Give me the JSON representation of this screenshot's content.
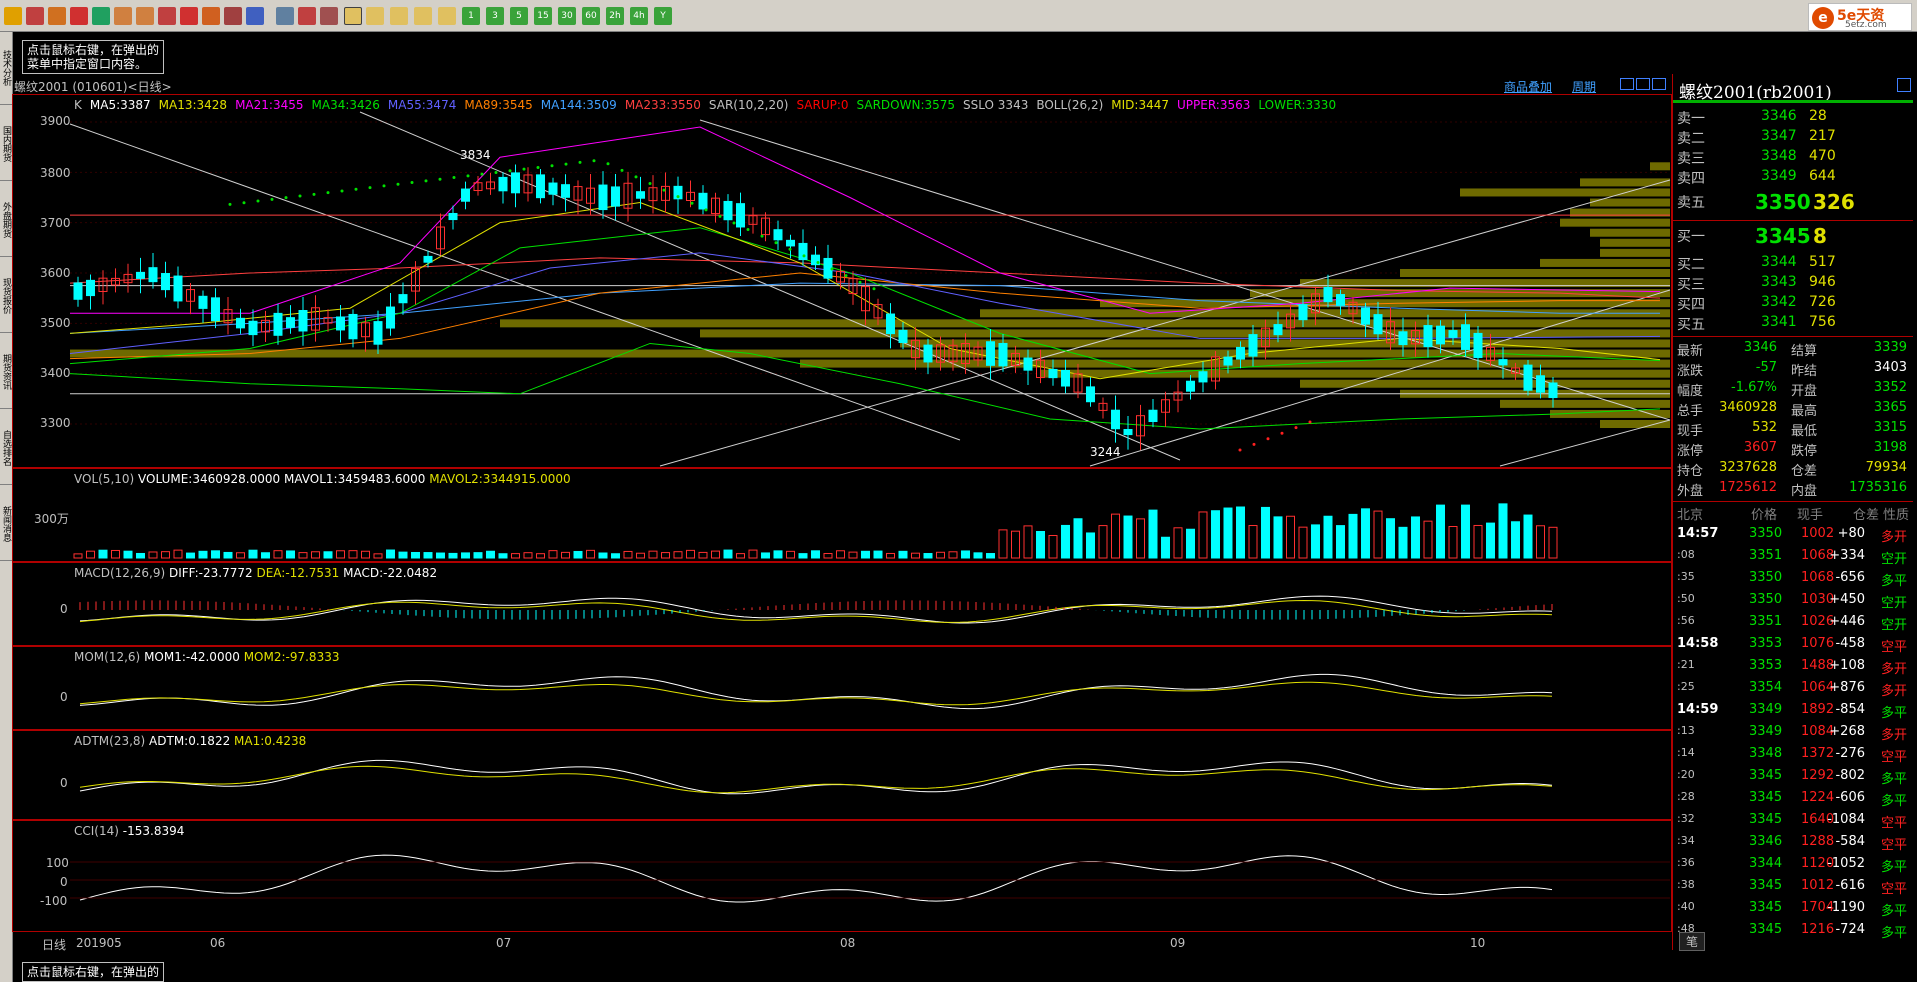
{
  "toolbar": {
    "logo_text": "5e天资",
    "logo_sub": "5etz.com",
    "numbered_buttons": [
      "1",
      "3",
      "5",
      "15",
      "30",
      "60",
      "2h",
      "4h",
      "Y"
    ]
  },
  "left_tabs": [
    "技术分析",
    "国内期货",
    "外盘期货",
    "现货报价",
    "期货资讯",
    "自选排名",
    "新闻消息"
  ],
  "hint": {
    "line1": "点击鼠标右键，在弹出的",
    "line2": "菜单中指定窗口内容。"
  },
  "hint_bottom": "点击鼠标右键，在弹出的",
  "chart_header": {
    "title": "螺纹2001 (010601)<日线>",
    "link_overlay": "商品叠加",
    "link_period": "周期"
  },
  "indicators": {
    "main": [
      {
        "text": "K",
        "color": "#c0c0c0"
      },
      {
        "text": "MA5:3387",
        "color": "#ffffff"
      },
      {
        "text": "MA13:3428",
        "color": "#e0e000"
      },
      {
        "text": "MA21:3455",
        "color": "#ff00ff"
      },
      {
        "text": "MA34:3426",
        "color": "#00e000"
      },
      {
        "text": "MA55:3474",
        "color": "#6060ff"
      },
      {
        "text": "MA89:3545",
        "color": "#ff8000"
      },
      {
        "text": "MA144:3509",
        "color": "#40a0ff"
      },
      {
        "text": "MA233:3550",
        "color": "#ff4040"
      },
      {
        "text": "SAR(10,2,20)",
        "color": "#c0c0c0"
      },
      {
        "text": "SARUP:0",
        "color": "#ff0000"
      },
      {
        "text": "SARDOWN:3575",
        "color": "#00e000"
      },
      {
        "text": "SSLO 3343",
        "color": "#c0c0c0"
      },
      {
        "text": "BOLL(26,2)",
        "color": "#c0c0c0"
      },
      {
        "text": "MID:3447",
        "color": "#e0e000"
      },
      {
        "text": "UPPER:3563",
        "color": "#ff00ff"
      },
      {
        "text": "LOWER:3330",
        "color": "#00e000"
      }
    ],
    "vol": [
      "VOL(5,10)",
      "VOLUME:3460928.0000",
      "MAVOL1:3459483.6000",
      "MAVOL2:3344915.0000"
    ],
    "macd": [
      "MACD(12,26,9)",
      "DIFF:-23.7772",
      "DEA:-12.7531",
      "MACD:-22.0482"
    ],
    "mom": [
      "MOM(12,6)",
      "MOM1:-42.0000",
      "MOM2:-97.8333"
    ],
    "adtm": [
      "ADTM(23,8)",
      "ADTM:0.1822",
      "MA1:0.4238"
    ],
    "cci": [
      "CCI(14)",
      "-153.8394"
    ]
  },
  "y_labels": {
    "price": [
      "3900",
      "3800",
      "3700",
      "3600",
      "3500",
      "3400",
      "3300"
    ],
    "vol": "300万",
    "macd": "0",
    "mom": "0",
    "adtm": "0",
    "cci": [
      "100",
      "0",
      "-100"
    ]
  },
  "annotations": {
    "high": "3834",
    "low": "3244"
  },
  "x_axis": {
    "label": "日线",
    "ticks": [
      "201905",
      "06",
      "07",
      "08",
      "09",
      "10"
    ]
  },
  "quote": {
    "title": "螺纹2001(rb2001)",
    "asks": [
      {
        "label": "卖五",
        "price": "3350",
        "vol": "326"
      },
      {
        "label": "卖四",
        "price": "3349",
        "vol": "644"
      },
      {
        "label": "卖三",
        "price": "3348",
        "vol": "470"
      },
      {
        "label": "卖二",
        "price": "3347",
        "vol": "217"
      },
      {
        "label": "卖一",
        "price": "3346",
        "vol": "28"
      }
    ],
    "bids": [
      {
        "label": "买一",
        "price": "3345",
        "vol": "8"
      },
      {
        "label": "买二",
        "price": "3344",
        "vol": "517"
      },
      {
        "label": "买三",
        "price": "3343",
        "vol": "946"
      },
      {
        "label": "买四",
        "price": "3342",
        "vol": "726"
      },
      {
        "label": "买五",
        "price": "3341",
        "vol": "756"
      }
    ],
    "stats": [
      [
        "最新",
        "3346",
        "#00e000",
        "结算",
        "3339",
        "#00e000"
      ],
      [
        "涨跌",
        "-57",
        "#00e000",
        "昨结",
        "3403",
        "#ffffff"
      ],
      [
        "幅度",
        "-1.67%",
        "#00e000",
        "开盘",
        "3352",
        "#00e000"
      ],
      [
        "总手",
        "3460928",
        "#e0e000",
        "最高",
        "3365",
        "#00e000"
      ],
      [
        "现手",
        "532",
        "#e0e000",
        "最低",
        "3315",
        "#00e000"
      ],
      [
        "涨停",
        "3607",
        "#ff2020",
        "跌停",
        "3198",
        "#00e000"
      ],
      [
        "持仓",
        "3237628",
        "#e0e000",
        "仓差",
        "79934",
        "#e0e000"
      ],
      [
        "外盘",
        "1725612",
        "#ff2020",
        "内盘",
        "1735316",
        "#00e000"
      ]
    ],
    "ticks_header": [
      "北京",
      "价格",
      "现手",
      "仓差",
      "性质"
    ],
    "ticks": [
      [
        "14:57",
        "3350",
        "1002",
        "+80",
        "多开"
      ],
      [
        ":08",
        "3351",
        "1068",
        "+334",
        "空开"
      ],
      [
        ":35",
        "3350",
        "1068",
        "-656",
        "多平"
      ],
      [
        ":50",
        "3350",
        "1030",
        "+450",
        "空开"
      ],
      [
        ":56",
        "3351",
        "1026",
        "+446",
        "空开"
      ],
      [
        "14:58",
        "3353",
        "1076",
        "-458",
        "空平"
      ],
      [
        ":21",
        "3353",
        "1488",
        "+108",
        "多开"
      ],
      [
        ":25",
        "3354",
        "1064",
        "+876",
        "多开"
      ],
      [
        "14:59",
        "3349",
        "1892",
        "-854",
        "多平"
      ],
      [
        ":13",
        "3349",
        "1084",
        "+268",
        "多开"
      ],
      [
        ":14",
        "3348",
        "1372",
        "-276",
        "空平"
      ],
      [
        ":20",
        "3345",
        "1292",
        "-802",
        "多平"
      ],
      [
        ":28",
        "3345",
        "1224",
        "-606",
        "多平"
      ],
      [
        ":32",
        "3345",
        "1640",
        "-1084",
        "空平"
      ],
      [
        ":34",
        "3346",
        "1288",
        "-584",
        "空平"
      ],
      [
        ":36",
        "3344",
        "1120",
        "-1052",
        "多平"
      ],
      [
        ":38",
        "3345",
        "1012",
        "-616",
        "空平"
      ],
      [
        ":40",
        "3345",
        "1704",
        "-1190",
        "多平"
      ],
      [
        ":48",
        "3345",
        "1216",
        "-724",
        "多平"
      ]
    ],
    "bottom_tab": "笔"
  },
  "colors": {
    "up": "#ff3030",
    "down": "#00ffff",
    "border": "#b00000",
    "label": "#c0c0c0",
    "green": "#00e000",
    "yellow": "#e0e000",
    "red": "#ff2020",
    "white": "#ffffff",
    "band": "#6e6a00"
  }
}
